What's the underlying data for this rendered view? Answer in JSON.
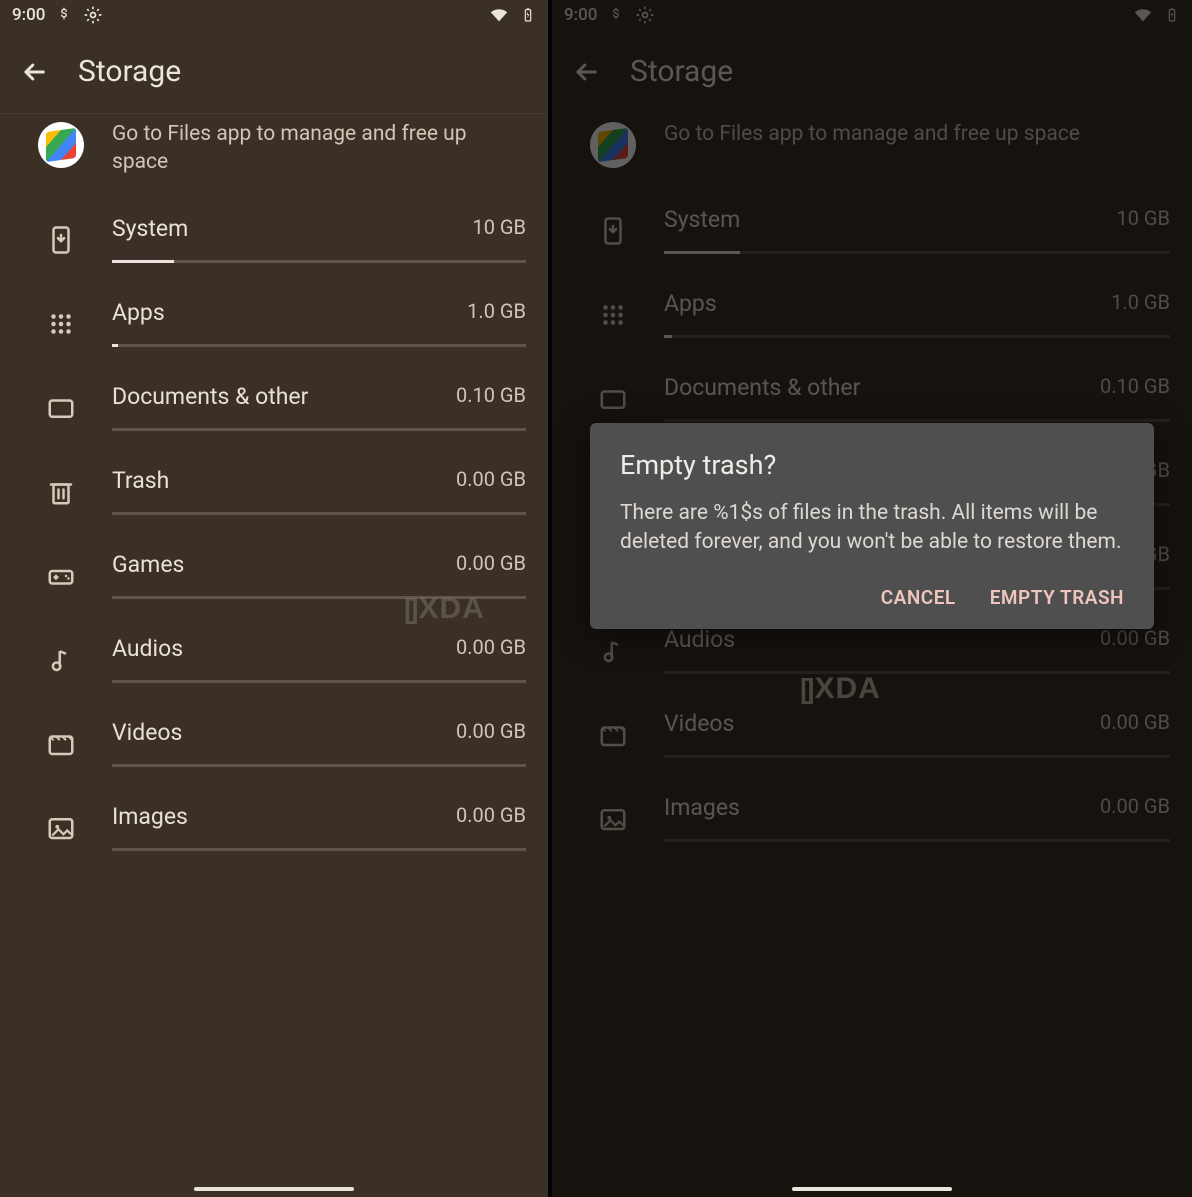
{
  "statusbar": {
    "time": "9:00"
  },
  "appbar": {
    "title": "Storage"
  },
  "files_tip": "Go to Files app to manage and free up space",
  "categories": [
    {
      "name": "System",
      "size": "10 GB",
      "fill": 15,
      "icon": "phone-down"
    },
    {
      "name": "Apps",
      "size": "1.0 GB",
      "fill": 1.5,
      "icon": "grid"
    },
    {
      "name": "Documents & other",
      "size": "0.10 GB",
      "fill": 0,
      "icon": "folder"
    },
    {
      "name": "Trash",
      "size": "0.00 GB",
      "fill": 0,
      "icon": "trash"
    },
    {
      "name": "Games",
      "size": "0.00 GB",
      "fill": 0,
      "icon": "gamepad"
    },
    {
      "name": "Audios",
      "size": "0.00 GB",
      "fill": 0,
      "icon": "music"
    },
    {
      "name": "Videos",
      "size": "0.00 GB",
      "fill": 0,
      "icon": "video"
    },
    {
      "name": "Images",
      "size": "0.00 GB",
      "fill": 0,
      "icon": "image"
    }
  ],
  "dialog": {
    "title": "Empty trash?",
    "body": "There are %1$s of files in the trash. All items will be deleted forever, and you won't be able to restore them.",
    "cancel": "CANCEL",
    "confirm": "EMPTY TRASH"
  },
  "watermark": "XDA"
}
